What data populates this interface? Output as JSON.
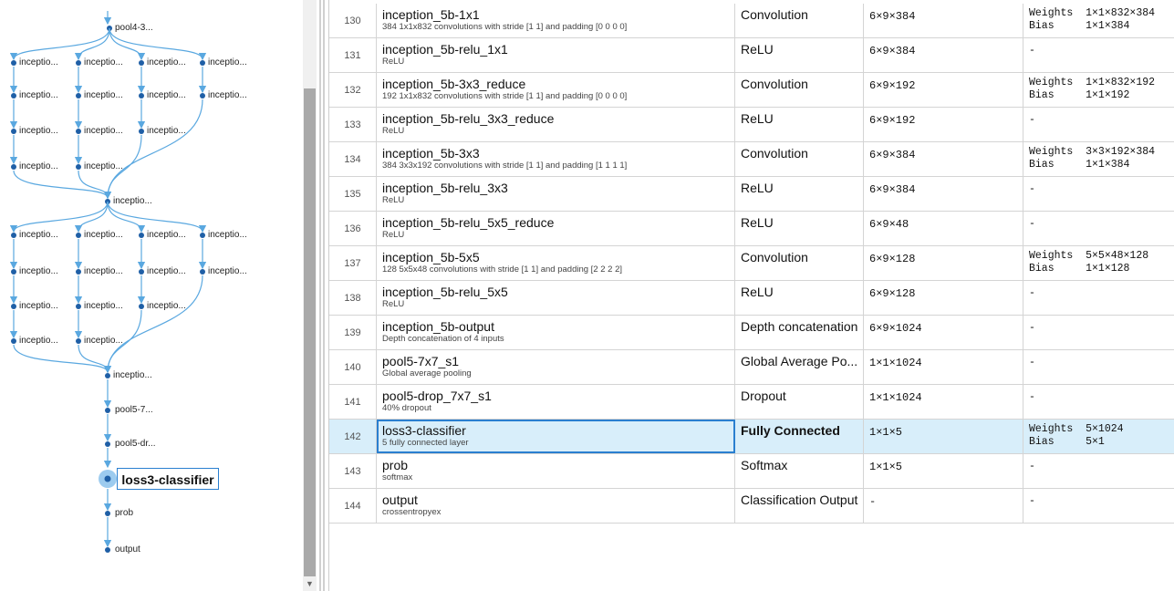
{
  "graph": {
    "labels": {
      "pool4": "pool4-3...",
      "inception": "inceptio...",
      "inception_merge": "inceptio...",
      "pool5_7": "pool5-7...",
      "pool5_dr": "pool5-dr...",
      "loss3": "loss3-classifier",
      "prob": "prob",
      "output": "output"
    }
  },
  "table": {
    "rows": [
      {
        "index": "130",
        "name": "inception_5b-1x1",
        "desc": "384 1x1x832 convolutions with stride [1 1] and padding [0 0 0 0]",
        "type": "Convolution",
        "activations": "6×9×384",
        "learnables": [
          "Weights  1×1×832×384",
          "Bias     1×1×384"
        ]
      },
      {
        "index": "131",
        "name": "inception_5b-relu_1x1",
        "desc": "ReLU",
        "type": "ReLU",
        "activations": "6×9×384",
        "learnables": [
          "-"
        ]
      },
      {
        "index": "132",
        "name": "inception_5b-3x3_reduce",
        "desc": "192 1x1x832 convolutions with stride [1 1] and padding [0 0 0 0]",
        "type": "Convolution",
        "activations": "6×9×192",
        "learnables": [
          "Weights  1×1×832×192",
          "Bias     1×1×192"
        ]
      },
      {
        "index": "133",
        "name": "inception_5b-relu_3x3_reduce",
        "desc": "ReLU",
        "type": "ReLU",
        "activations": "6×9×192",
        "learnables": [
          "-"
        ]
      },
      {
        "index": "134",
        "name": "inception_5b-3x3",
        "desc": "384 3x3x192 convolutions with stride [1 1] and padding [1 1 1 1]",
        "type": "Convolution",
        "activations": "6×9×384",
        "learnables": [
          "Weights  3×3×192×384",
          "Bias     1×1×384"
        ]
      },
      {
        "index": "135",
        "name": "inception_5b-relu_3x3",
        "desc": "ReLU",
        "type": "ReLU",
        "activations": "6×9×384",
        "learnables": [
          "-"
        ]
      },
      {
        "index": "136",
        "name": "inception_5b-relu_5x5_reduce",
        "desc": "ReLU",
        "type": "ReLU",
        "activations": "6×9×48",
        "learnables": [
          "-"
        ]
      },
      {
        "index": "137",
        "name": "inception_5b-5x5",
        "desc": "128 5x5x48 convolutions with stride [1 1] and padding [2 2 2 2]",
        "type": "Convolution",
        "activations": "6×9×128",
        "learnables": [
          "Weights  5×5×48×128",
          "Bias     1×1×128"
        ]
      },
      {
        "index": "138",
        "name": "inception_5b-relu_5x5",
        "desc": "ReLU",
        "type": "ReLU",
        "activations": "6×9×128",
        "learnables": [
          "-"
        ]
      },
      {
        "index": "139",
        "name": "inception_5b-output",
        "desc": "Depth concatenation of 4 inputs",
        "type": "Depth concatenation",
        "activations": "6×9×1024",
        "learnables": [
          "-"
        ]
      },
      {
        "index": "140",
        "name": "pool5-7x7_s1",
        "desc": "Global average pooling",
        "type": "Global Average Po...",
        "activations": "1×1×1024",
        "learnables": [
          "-"
        ]
      },
      {
        "index": "141",
        "name": "pool5-drop_7x7_s1",
        "desc": "40% dropout",
        "type": "Dropout",
        "activations": "1×1×1024",
        "learnables": [
          "-"
        ]
      },
      {
        "index": "142",
        "name": "loss3-classifier",
        "desc": "5 fully connected layer",
        "type": "Fully Connected",
        "activations": "1×1×5",
        "learnables": [
          "Weights  5×1024",
          "Bias     5×1"
        ],
        "selected": true
      },
      {
        "index": "143",
        "name": "prob",
        "desc": "softmax",
        "type": "Softmax",
        "activations": "1×1×5",
        "learnables": [
          "-"
        ]
      },
      {
        "index": "144",
        "name": "output",
        "desc": "crossentropyex",
        "type": "Classification Output",
        "activations": "-",
        "learnables": [
          "-"
        ]
      }
    ]
  },
  "colors": {
    "edge": "#5aa8e0",
    "node": "#1f5fa6",
    "selected_bg": "#d8eefa",
    "selected_border": "#2a7fd0"
  }
}
